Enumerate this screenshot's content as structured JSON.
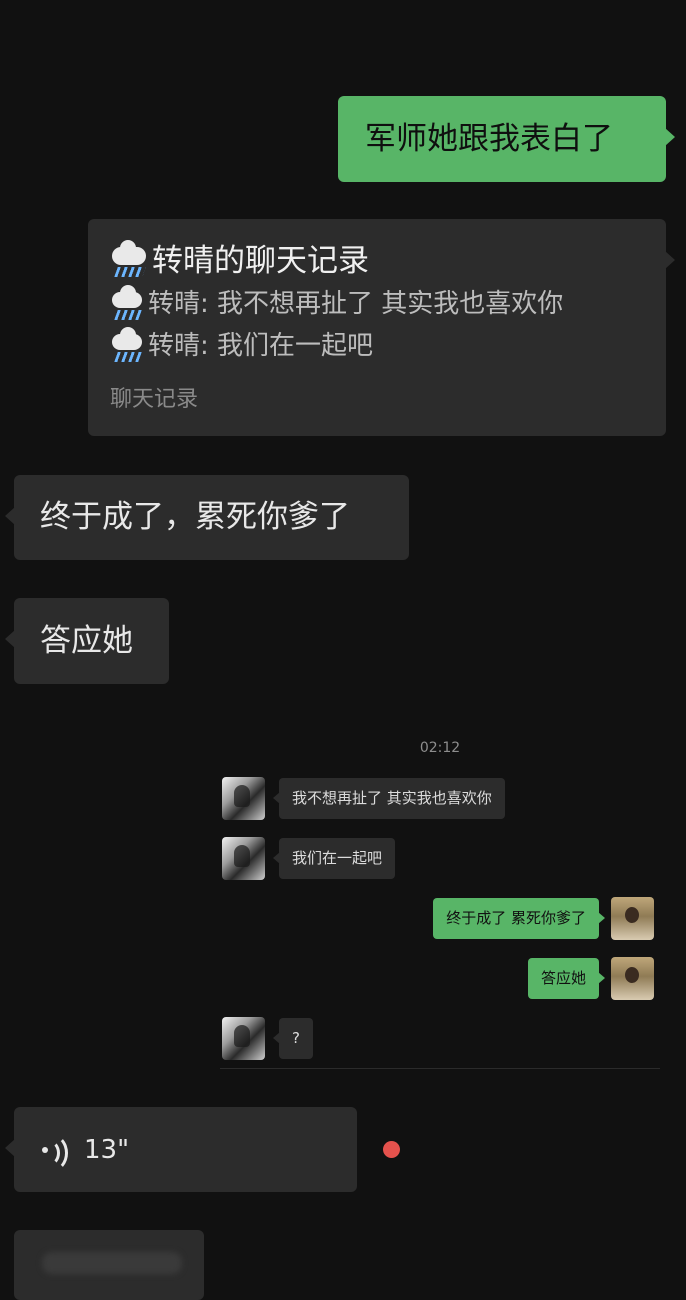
{
  "messages": {
    "top_right": "军师她跟我表白了",
    "finally": "终于成了，累死你爹了",
    "accept": "答应她",
    "voice_duration": "13\""
  },
  "chat_record_card": {
    "title": "转晴的聊天记录",
    "lines": [
      "转晴: 我不想再扯了 其实我也喜欢你",
      "转晴: 我们在一起吧"
    ],
    "footer": "聊天记录",
    "icon": "rain-cloud-icon"
  },
  "embedded_chat": {
    "timestamp": "02:12",
    "messages": [
      {
        "side": "left",
        "text": "我不想再扯了 其实我也喜欢你"
      },
      {
        "side": "left",
        "text": "我们在一起吧"
      },
      {
        "side": "right",
        "text": "终于成了 累死你爹了"
      },
      {
        "side": "right",
        "text": "答应她"
      },
      {
        "side": "left",
        "text": "?"
      }
    ]
  },
  "colors": {
    "background": "#111111",
    "bubble_left": "#2c2c2c",
    "bubble_right": "#58b567",
    "unread_dot": "#e5524d"
  }
}
